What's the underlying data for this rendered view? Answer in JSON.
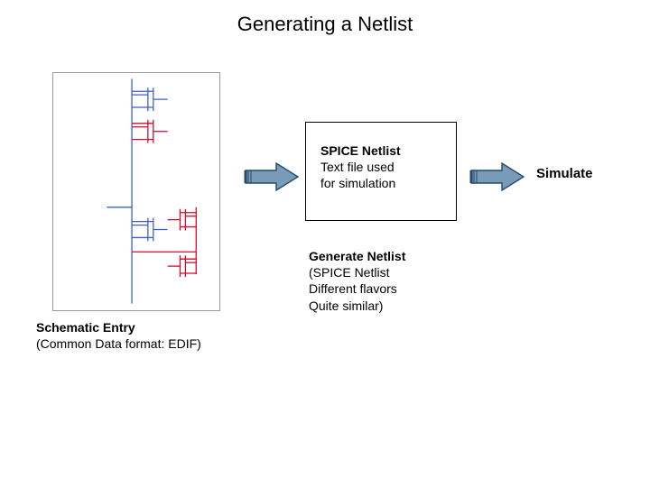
{
  "title": "Generating a Netlist",
  "schematic_caption_title": "Schematic Entry",
  "schematic_caption_sub": "(Common Data format:  EDIF)",
  "netlist": {
    "heading": "SPICE Netlist",
    "line1": "Text file used",
    "line2": "for simulation"
  },
  "generate": {
    "heading": "Generate Netlist",
    "line1": "(SPICE Netlist",
    "line2": "Different flavors",
    "line3": "Quite similar)"
  },
  "simulate_label": "Simulate",
  "colors": {
    "arrow_fill": "#7a9bb8",
    "arrow_stroke": "#244a6e",
    "trans_blue": "#3a5fd0",
    "trans_red": "#d50a2a"
  }
}
